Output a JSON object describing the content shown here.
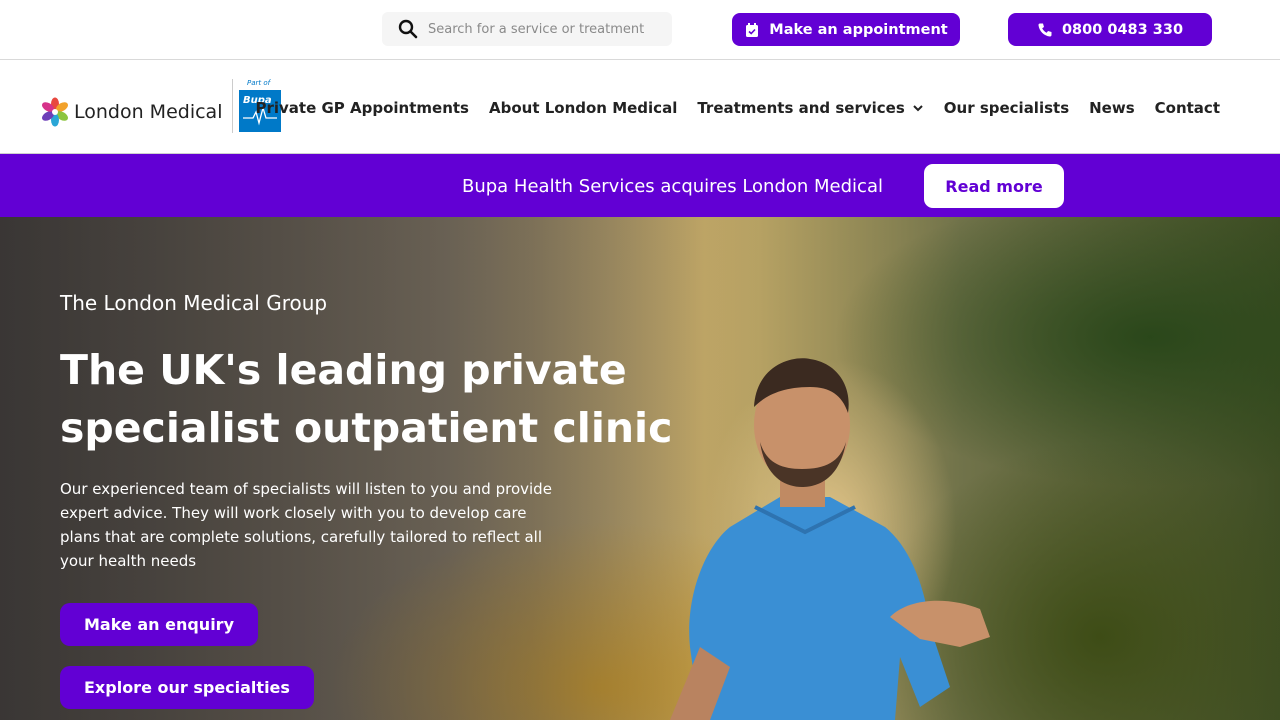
{
  "topbar": {
    "search_placeholder": "Search for a service or treatment",
    "appointment_label": "Make an appointment",
    "phone_label": "0800 0483 330"
  },
  "logo": {
    "name": "London Medical",
    "badge_part_of": "Part of",
    "badge_brand": "Bupa"
  },
  "nav": {
    "items": [
      {
        "label": "Private GP Appointments"
      },
      {
        "label": "About London Medical"
      },
      {
        "label": "Treatments and services"
      },
      {
        "label": "Our specialists"
      },
      {
        "label": "News"
      },
      {
        "label": "Contact"
      }
    ]
  },
  "banner": {
    "text": "Bupa Health Services acquires London Medical",
    "button_label": "Read more"
  },
  "hero": {
    "kicker": "The London Medical Group",
    "title": "The UK's leading private specialist outpatient clinic",
    "body": "Our experienced team of specialists will listen to you and provide expert advice. They will work closely with you to develop care plans that are complete solutions, carefully tailored to reflect all your health needs",
    "enquiry_label": "Make an enquiry",
    "explore_label": "Explore our specialties"
  },
  "colors": {
    "accent": "#6200d4",
    "bupa_blue": "#0079c8"
  },
  "icons": {
    "search": "search-icon",
    "calendar": "calendar-check-icon",
    "phone": "phone-icon",
    "chevron": "chevron-down-icon"
  }
}
